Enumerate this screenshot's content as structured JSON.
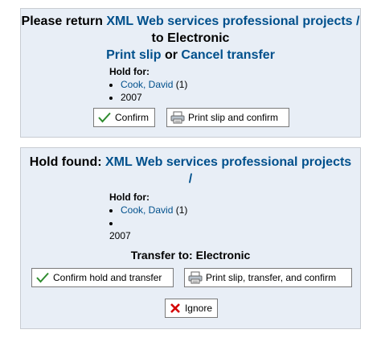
{
  "return_panel": {
    "heading_prefix": "Please return",
    "title_link": "XML Web services professional projects /",
    "heading_to": "to Electronic",
    "print_slip_link": "Print slip",
    "or_text": "or",
    "cancel_transfer_link": "Cancel transfer",
    "hold_for_label": "Hold for:",
    "patron_name": "Cook, David",
    "patron_count": "(1)",
    "year": "2007",
    "confirm_label": "Confirm",
    "print_confirm_label": "Print slip and confirm"
  },
  "hold_panel": {
    "heading_prefix": "Hold found:",
    "title_link_line1": "XML Web services professional projects",
    "title_link_line2": "/",
    "hold_for_label": "Hold for:",
    "patron_name": "Cook, David",
    "patron_count": "(1)",
    "year": "2007",
    "transfer_to": "Transfer to: Electronic",
    "confirm_transfer_label": "Confirm hold and transfer",
    "print_transfer_label": "Print slip, transfer, and confirm",
    "ignore_label": "Ignore"
  },
  "icons": {
    "confirm": "check-icon",
    "print": "printer-icon",
    "ignore": "x-icon"
  },
  "colors": {
    "link": "#00508c",
    "panel_bg": "#e8eef6",
    "check": "#2e8b2e",
    "ignore": "#d40000"
  }
}
